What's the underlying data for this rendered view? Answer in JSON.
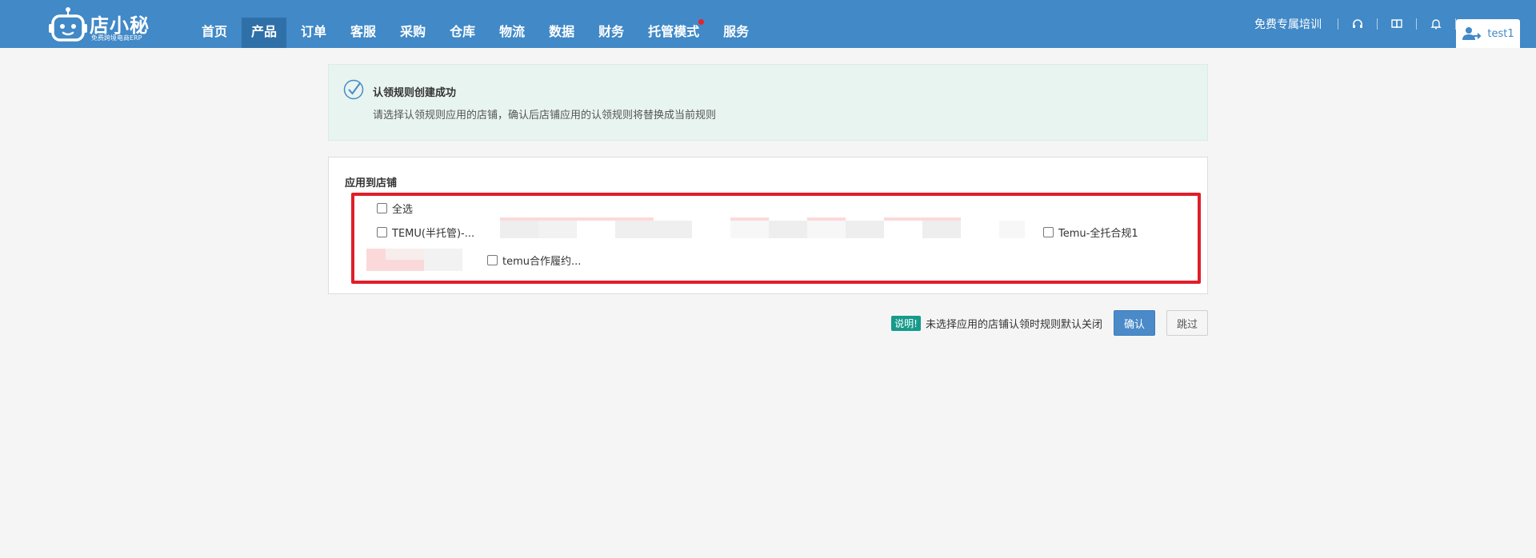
{
  "header": {
    "brand": "店小秘",
    "brand_sub": "免费跨境电商ERP",
    "nav": [
      {
        "label": "首页"
      },
      {
        "label": "产品",
        "active": true
      },
      {
        "label": "订单"
      },
      {
        "label": "客服"
      },
      {
        "label": "采购"
      },
      {
        "label": "仓库"
      },
      {
        "label": "物流"
      },
      {
        "label": "数据"
      },
      {
        "label": "财务"
      },
      {
        "label": "托管模式",
        "has_dot": true
      },
      {
        "label": "服务"
      }
    ],
    "training": "免费专属培训",
    "icons": [
      "headset-icon",
      "book-icon",
      "bell-icon"
    ],
    "user": "test1"
  },
  "notice": {
    "title": "认领规则创建成功",
    "desc": "请选择认领规则应用的店铺，确认后店铺应用的认领规则将替换成当前规则"
  },
  "panel": {
    "title": "应用到店铺",
    "select_all": "全选",
    "stores": [
      "TEMU(半托管)-...",
      "Temu-全托合规1",
      "temu合作履约..."
    ]
  },
  "footer": {
    "badge": "说明!",
    "note": "未选择应用的店铺认领时规则默认关闭",
    "confirm": "确认",
    "skip": "跳过"
  },
  "colors": {
    "header_bg": "#4189c7",
    "active_nav": "#2f70a8",
    "highlight_border": "#e01e2a",
    "notice_bg": "#e8f4ef",
    "badge_bg": "#169b8b",
    "confirm_bg": "#4a8ac9"
  }
}
